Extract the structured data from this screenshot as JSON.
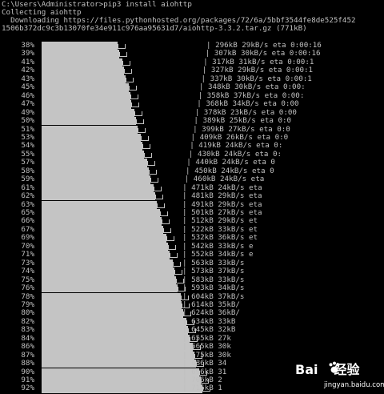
{
  "header": {
    "line1": "C:\\Users\\Administrator>pip3 install aiohttp",
    "line2": "Collecting aiohttp",
    "line3": "  Downloading https://files.pythonhosted.org/packages/72/6a/5bbf3544fe8de525f452",
    "line4": "1506b372dc9c3b13070fe34e911c976aa95631d7/aiohttp-3.3.2.tar.gz (771kB)"
  },
  "progress_rows": [
    {
      "pct": "38%",
      "stat": "| 296kB 29kB/s eta 0:00:16",
      "fill": 0.38
    },
    {
      "pct": "39%",
      "stat": "| 307kB 30kB/s eta 0:00:16",
      "fill": 0.39
    },
    {
      "pct": "41%",
      "stat": "| 317kB 31kB/s eta 0:00:1",
      "fill": 0.41
    },
    {
      "pct": "42%",
      "stat": "| 327kB 29kB/s eta 0:00:1",
      "fill": 0.42
    },
    {
      "pct": "43%",
      "stat": "| 337kB 30kB/s eta 0:00:1",
      "fill": 0.43
    },
    {
      "pct": "45%",
      "stat": "| 348kB 30kB/s eta 0:00:",
      "fill": 0.45
    },
    {
      "pct": "46%",
      "stat": "| 358kB 37kB/s eta 0:00:",
      "fill": 0.46
    },
    {
      "pct": "47%",
      "stat": "| 368kB 34kB/s eta 0:00",
      "fill": 0.47
    },
    {
      "pct": "49%",
      "stat": "| 378kB 23kB/s eta 0:00",
      "fill": 0.49
    },
    {
      "pct": "50%",
      "stat": "| 389kB 25kB/s eta 0:0",
      "fill": 0.5
    },
    {
      "pct": "51%",
      "stat": "| 399kB 27kB/s eta 0:0",
      "fill": 0.51
    },
    {
      "pct": "53%",
      "stat": "| 409kB 26kB/s eta 0:0",
      "fill": 0.53
    },
    {
      "pct": "54%",
      "stat": "| 419kB 24kB/s eta 0:",
      "fill": 0.54
    },
    {
      "pct": "55%",
      "stat": "| 430kB 24kB/s eta 0:",
      "fill": 0.55
    },
    {
      "pct": "57%",
      "stat": "| 440kB 24kB/s eta 0",
      "fill": 0.57
    },
    {
      "pct": "58%",
      "stat": "| 450kB 24kB/s eta 0",
      "fill": 0.58
    },
    {
      "pct": "59%",
      "stat": "| 460kB 24kB/s eta",
      "fill": 0.59
    },
    {
      "pct": "61%",
      "stat": "| 471kB 24kB/s eta",
      "fill": 0.61
    },
    {
      "pct": "62%",
      "stat": "| 481kB 29kB/s eta",
      "fill": 0.62
    },
    {
      "pct": "63%",
      "stat": "| 491kB 29kB/s eta",
      "fill": 0.63
    },
    {
      "pct": "65%",
      "stat": "| 501kB 27kB/s eta",
      "fill": 0.65
    },
    {
      "pct": "66%",
      "stat": "| 512kB 29kB/s et",
      "fill": 0.66
    },
    {
      "pct": "67%",
      "stat": "| 522kB 33kB/s et",
      "fill": 0.67
    },
    {
      "pct": "69%",
      "stat": "| 532kB 36kB/s et",
      "fill": 0.69
    },
    {
      "pct": "70%",
      "stat": "| 542kB 33kB/s e",
      "fill": 0.7
    },
    {
      "pct": "71%",
      "stat": "| 552kB 34kB/s e",
      "fill": 0.71
    },
    {
      "pct": "73%",
      "stat": "| 563kB 33kB/s",
      "fill": 0.73
    },
    {
      "pct": "74%",
      "stat": "| 573kB 37kB/s",
      "fill": 0.74
    },
    {
      "pct": "75%",
      "stat": "| 583kB 33kB/s",
      "fill": 0.75
    },
    {
      "pct": "76%",
      "stat": "| 593kB 34kB/s",
      "fill": 0.76
    },
    {
      "pct": "78%",
      "stat": "| 604kB 37kB/s",
      "fill": 0.78
    },
    {
      "pct": "79%",
      "stat": "| 614kB 35kB/",
      "fill": 0.79
    },
    {
      "pct": "80%",
      "stat": "| 624kB 36kB/",
      "fill": 0.8
    },
    {
      "pct": "82%",
      "stat": "| 634kB 33kB",
      "fill": 0.82
    },
    {
      "pct": "83%",
      "stat": "| 645kB 32kB",
      "fill": 0.83
    },
    {
      "pct": "84%",
      "stat": "| 655kB 27k",
      "fill": 0.84
    },
    {
      "pct": "86%",
      "stat": "| 665kB 30k",
      "fill": 0.86
    },
    {
      "pct": "87%",
      "stat": "| 675kB 30k",
      "fill": 0.87
    },
    {
      "pct": "88%",
      "stat": "| 686kB 34",
      "fill": 0.88
    },
    {
      "pct": "90%",
      "stat": "| 696kB 31",
      "fill": 0.9
    },
    {
      "pct": "91%",
      "stat": "| 706kB 2",
      "fill": 0.91
    },
    {
      "pct": "92%",
      "stat": "| 716kB 1",
      "fill": 0.92
    }
  ],
  "watermark": {
    "logo_left": "Bai",
    "logo_right": "经验",
    "sub": "jingyan.baidu.com"
  }
}
